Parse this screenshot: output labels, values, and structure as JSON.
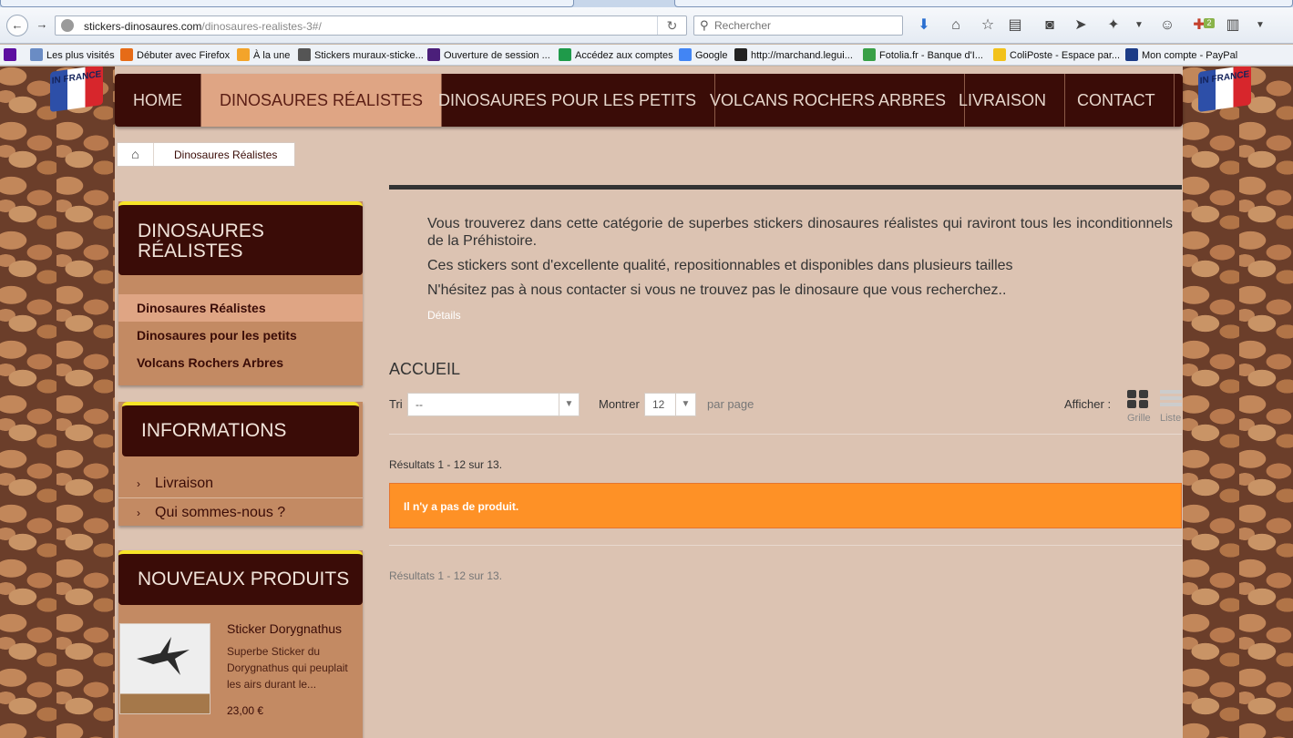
{
  "browser": {
    "url_domain": "stickers-dinosaures.com",
    "url_path": "/dinosaures-realistes-3#/",
    "search_placeholder": "Rechercher",
    "addon_badge": "2",
    "bookmarks": [
      {
        "label": "",
        "color": "#5c0fa0",
        "name": "yahoo"
      },
      {
        "label": "Les plus visités",
        "color": "#6a8cc4",
        "name": "most-visited"
      },
      {
        "label": "Débuter avec Firefox",
        "color": "#e66b17",
        "name": "getting-started"
      },
      {
        "label": "À la une",
        "color": "#f3a42a",
        "name": "rss"
      },
      {
        "label": "Stickers muraux-sticke...",
        "color": "#555555",
        "name": "stickers-muraux"
      },
      {
        "label": "Ouverture de session ...",
        "color": "#4b1f7a",
        "name": "session"
      },
      {
        "label": "Accédez aux comptes",
        "color": "#1f9a4a",
        "name": "comptes"
      },
      {
        "label": "Google",
        "color": "#4285f4",
        "name": "google"
      },
      {
        "label": "http://marchand.legui...",
        "color": "#222222",
        "name": "marchand"
      },
      {
        "label": "Fotolia.fr - Banque d'I...",
        "color": "#39a047",
        "name": "fotolia"
      },
      {
        "label": "ColiPoste - Espace par...",
        "color": "#f2c21b",
        "name": "colipost"
      },
      {
        "label": "Mon compte - PayPal",
        "color": "#1d3c87",
        "name": "paypal"
      }
    ]
  },
  "flag_text": "IN FRANCE",
  "menu": [
    {
      "label": "HOME"
    },
    {
      "label": "DINOSAURES RÉALISTES",
      "active": true
    },
    {
      "label": "DINOSAURES POUR LES PETITS"
    },
    {
      "label": "VOLCANS ROCHERS ARBRES"
    },
    {
      "label": "LIVRAISON"
    },
    {
      "label": "CONTACT"
    }
  ],
  "breadcrumb": {
    "current": "Dinosaures Réalistes"
  },
  "sidebar": {
    "category_title": "DINOSAURES RÉALISTES",
    "categories": [
      {
        "label": "Dinosaures Réalistes",
        "active": true
      },
      {
        "label": "Dinosaures pour les petits"
      },
      {
        "label": "Volcans Rochers Arbres"
      }
    ],
    "info_title": "INFORMATIONS",
    "info_links": [
      {
        "label": "Livraison"
      },
      {
        "label": "Qui sommes-nous ?"
      }
    ],
    "new_title": "NOUVEAUX PRODUITS",
    "product": {
      "name": "Sticker Dorygnathus",
      "desc": "Superbe Sticker du Dorygnathus qui peuplait les airs durant le...",
      "price": "23,00 €"
    }
  },
  "main": {
    "intro": [
      "Vous trouverez dans cette catégorie de superbes stickers dinosaures réalistes qui raviront tous les inconditionnels de la Préhistoire.",
      "Ces stickers sont d'excellente qualité, repositionnables et disponibles dans plusieurs tailles",
      "N'hésitez pas à nous contacter si vous ne trouvez pas le dinosaure que vous recherchez.."
    ],
    "details": "Détails",
    "heading": "ACCUEIL",
    "sort_label": "Tri",
    "sort_value": "--",
    "show_label": "Montrer",
    "show_value": "12",
    "per_page": "par page",
    "display_label": "Afficher :",
    "grid_label": "Grille",
    "list_label": "Liste",
    "results_top": "Résultats 1 - 12 sur 13.",
    "alert": "Il n'y a pas de produit.",
    "results_bottom": "Résultats 1 - 12 sur 13."
  }
}
